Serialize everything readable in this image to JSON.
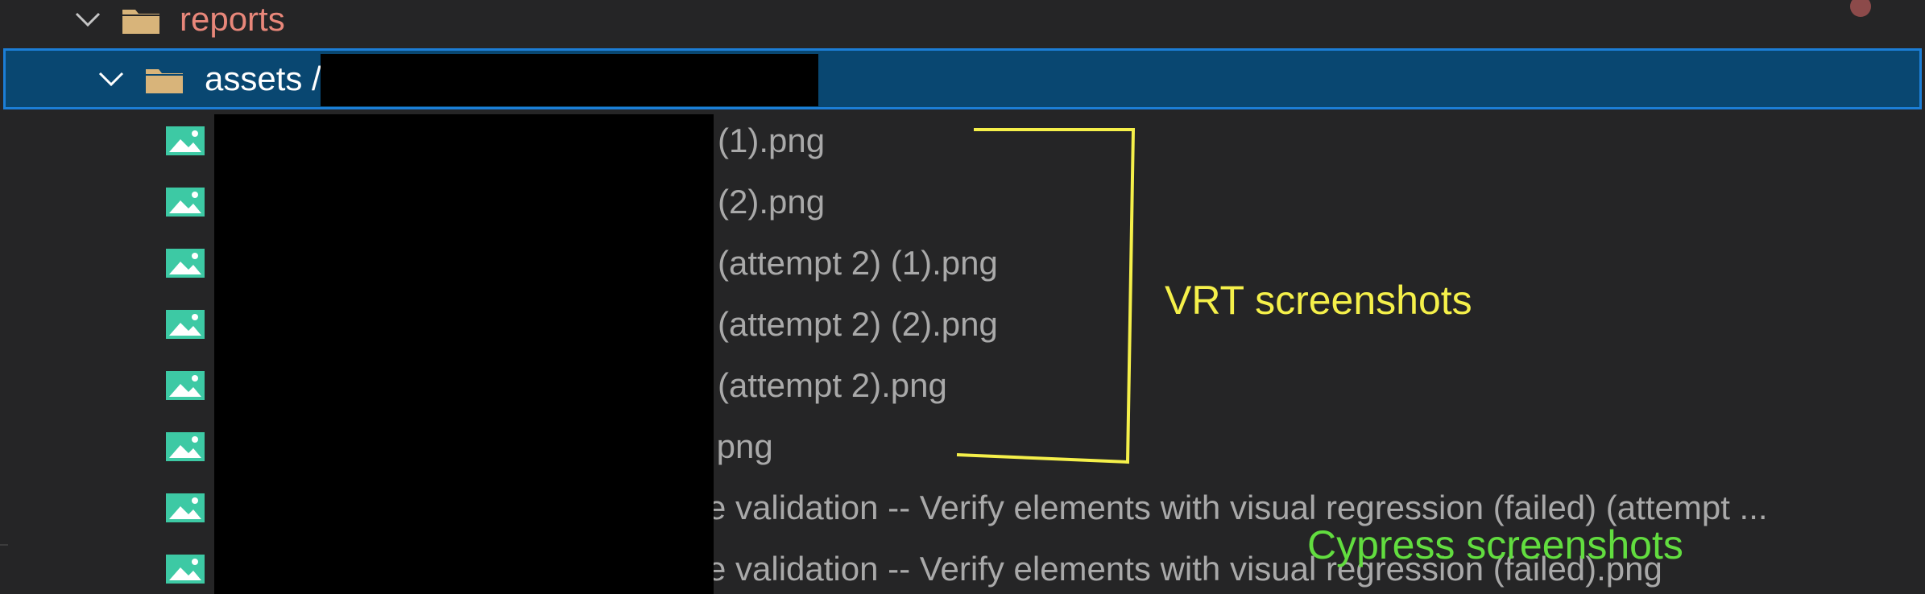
{
  "colors": {
    "background": "#252526",
    "selection": "#094771",
    "selection_border": "#1c7ed6",
    "folder_reports_text": "#e8877a",
    "selected_text": "#ffffff",
    "file_text": "#a9a9a9",
    "folder_icon": "#d8b47a",
    "image_icon": "#3dc9a4",
    "modified_dot": "#8c4a4a",
    "annotation_yellow": "#f5f04a",
    "annotation_green": "#62dd3f"
  },
  "explorer": {
    "folders": [
      {
        "name": "reports",
        "expanded": true,
        "icon": "folder-icon",
        "chevron": "chevron-down-icon"
      },
      {
        "name": "assets /",
        "expanded": true,
        "selected": true,
        "icon": "folder-icon",
        "chevron": "chevron-down-icon"
      }
    ],
    "files": [
      {
        "name": "(1).png",
        "icon": "image-file-icon"
      },
      {
        "name": "(2).png",
        "icon": "image-file-icon"
      },
      {
        "name": "(attempt 2) (1).png",
        "icon": "image-file-icon"
      },
      {
        "name": "(attempt 2) (2).png",
        "icon": "image-file-icon"
      },
      {
        "name": "(attempt 2).png",
        "icon": "image-file-icon"
      },
      {
        "name": ".png",
        "icon": "image-file-icon"
      },
      {
        "name": "e validation -- Verify elements with visual regression (failed) (attempt ...",
        "icon": "image-file-icon"
      },
      {
        "name": "e validation -- Verify elements with visual regression (failed).png",
        "icon": "image-file-icon"
      }
    ]
  },
  "annotations": {
    "vrt_label": "VRT screenshots",
    "cypress_label": "Cypress screenshots"
  }
}
